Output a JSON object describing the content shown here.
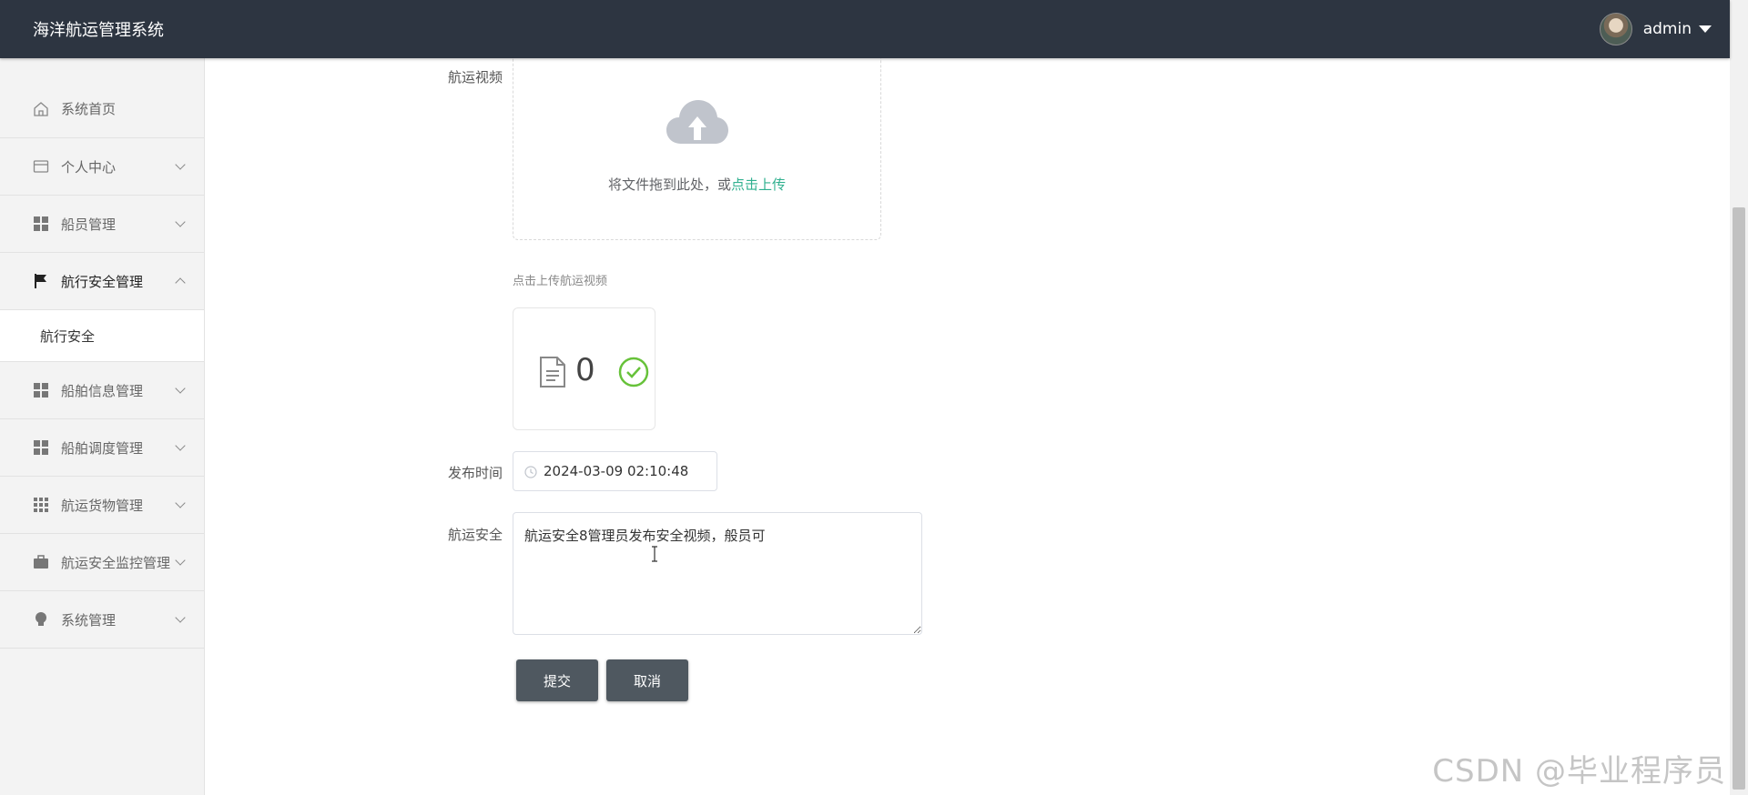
{
  "header": {
    "app_title": "海洋航运管理系统",
    "username": "admin"
  },
  "sidebar": {
    "items": [
      {
        "label": "系统首页",
        "icon": "home-icon"
      },
      {
        "label": "个人中心",
        "icon": "card-icon"
      },
      {
        "label": "船员管理",
        "icon": "grid-icon"
      },
      {
        "label": "航行安全管理",
        "icon": "flag-icon",
        "expanded": true,
        "children": [
          {
            "label": "航行安全"
          }
        ]
      },
      {
        "label": "船舶信息管理",
        "icon": "grid-icon"
      },
      {
        "label": "船舶调度管理",
        "icon": "grid-icon"
      },
      {
        "label": "航运货物管理",
        "icon": "grid9-icon"
      },
      {
        "label": "航运安全监控管理",
        "icon": "briefcase-icon"
      },
      {
        "label": "系统管理",
        "icon": "bulb-icon"
      }
    ]
  },
  "form": {
    "video_label": "航运视频",
    "upload_text": "将文件拖到此处，或",
    "upload_link": "点击上传",
    "upload_tip": "点击上传航运视频",
    "file_count": "0",
    "publish_time_label": "发布时间",
    "publish_time_value": "2024-03-09 02:10:48",
    "safety_label": "航运安全",
    "safety_value": "航运安全8管理员发布安全视频，般员可",
    "submit_label": "提交",
    "cancel_label": "取消"
  },
  "watermark": "CSDN @毕业程序员",
  "colors": {
    "header_bg": "#2d3541",
    "link": "#30b08f",
    "button_bg": "#4f5860",
    "success": "#67c23a"
  }
}
